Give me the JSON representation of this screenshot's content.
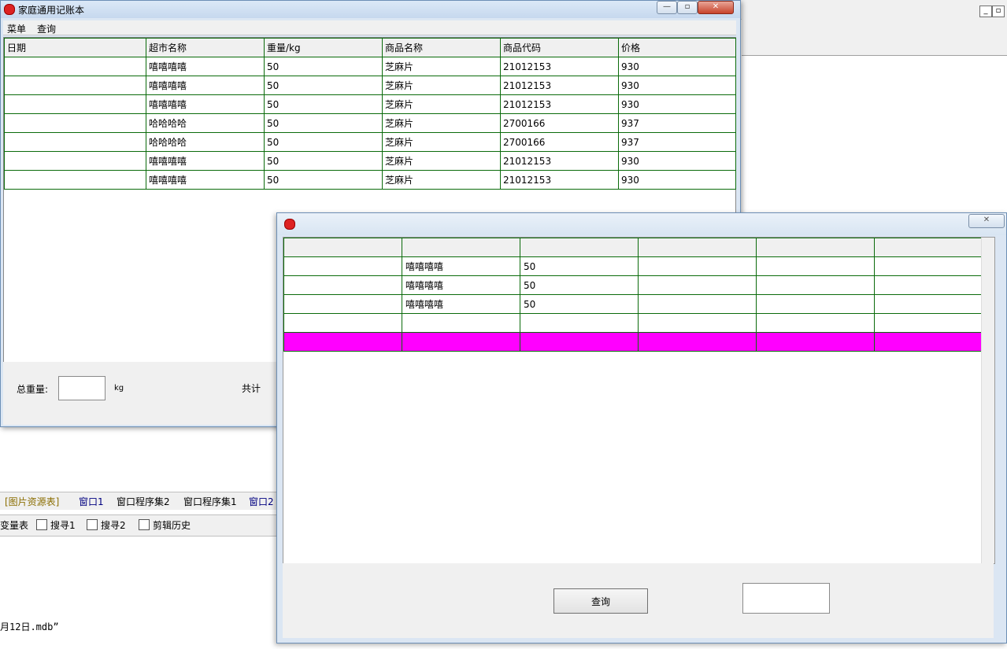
{
  "background": {
    "tabs": [
      "[图片资源表]",
      "窗口1",
      "窗口程序集2",
      "窗口程序集1",
      "窗口2"
    ],
    "tools": [
      "变量表",
      "搜寻1",
      "搜寻2",
      "剪辑历史"
    ],
    "status_text": "月12日.mdb”",
    "mdi_buttons": [
      "_",
      "▫"
    ]
  },
  "window1": {
    "title": "家庭通用记账本",
    "caption_buttons": [
      "—",
      "▫",
      "✕"
    ],
    "menu": [
      "菜单",
      "查询"
    ],
    "table": {
      "headers": [
        "日期",
        "超市名称",
        "重量/kg",
        "商品名称",
        "商品代码",
        "价格"
      ],
      "rows": [
        [
          "",
          "嘻嘻嘻嘻",
          "50",
          "芝麻片",
          "21012153",
          "930"
        ],
        [
          "",
          "嘻嘻嘻嘻",
          "50",
          "芝麻片",
          "21012153",
          "930"
        ],
        [
          "",
          "嘻嘻嘻嘻",
          "50",
          "芝麻片",
          "21012153",
          "930"
        ],
        [
          "",
          "哈哈哈哈",
          "50",
          "芝麻片",
          "2700166",
          "937"
        ],
        [
          "",
          "哈哈哈哈",
          "50",
          "芝麻片",
          "2700166",
          "937"
        ],
        [
          "",
          "嘻嘻嘻嘻",
          "50",
          "芝麻片",
          "21012153",
          "930"
        ],
        [
          "",
          "嘻嘻嘻嘻",
          "50",
          "芝麻片",
          "21012153",
          "930"
        ]
      ]
    },
    "footer": {
      "total_weight_label": "总重量:",
      "total_weight_value": "",
      "unit": "kg",
      "total_label": "共计"
    }
  },
  "window2": {
    "close_button": "✕",
    "table": {
      "rows": [
        [
          "",
          "",
          "",
          "",
          "",
          ""
        ],
        [
          "",
          "嘻嘻嘻嘻",
          "50",
          "",
          "",
          ""
        ],
        [
          "",
          "嘻嘻嘻嘻",
          "50",
          "",
          "",
          ""
        ],
        [
          "",
          "嘻嘻嘻嘻",
          "50",
          "",
          "",
          ""
        ],
        [
          "",
          "",
          "",
          "",
          "",
          ""
        ],
        [
          "",
          "",
          "",
          "",
          "",
          ""
        ]
      ],
      "highlight_color": "#ff00ff"
    },
    "query_button": "查询",
    "result_value": ""
  }
}
